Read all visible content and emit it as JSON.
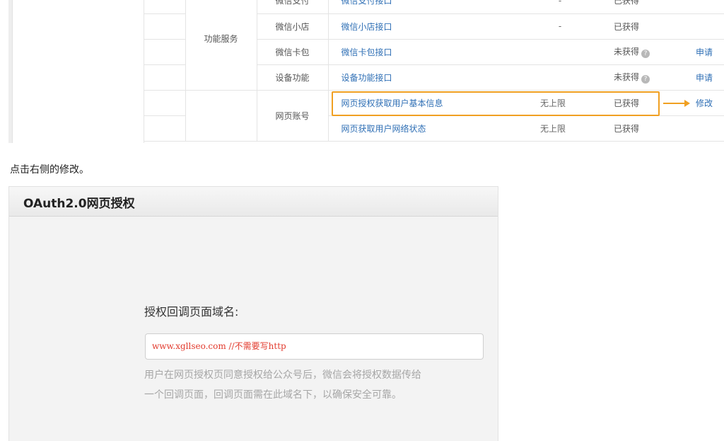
{
  "table": {
    "rows": [
      {
        "category": "",
        "name": "微信支付",
        "api": "微信支付接口",
        "limit": "-",
        "status": "已获得",
        "action": ""
      },
      {
        "category": "功能服务",
        "name": "微信小店",
        "api": "微信小店接口",
        "limit": "-",
        "status": "已获得",
        "action": ""
      },
      {
        "category": "",
        "name": "微信卡包",
        "api": "微信卡包接口",
        "limit": "",
        "status": "未获得",
        "action": "申请"
      },
      {
        "category": "",
        "name": "设备功能",
        "api": "设备功能接口",
        "limit": "",
        "status": "未获得",
        "action": "申请"
      },
      {
        "category": "",
        "name": "网页账号",
        "api": "网页授权获取用户基本信息",
        "limit": "无上限",
        "status": "已获得",
        "action": "修改"
      },
      {
        "category": "",
        "name": "",
        "api": "网页获取用户网络状态",
        "limit": "无上限",
        "status": "已获得",
        "action": ""
      }
    ],
    "help_icon": "question-circle-icon",
    "highlight_color": "#f0a022"
  },
  "caption": "点击右侧的修改。",
  "oauth": {
    "title": "OAuth2.0网页授权",
    "field_label": "授权回调页面域名:",
    "input_value": "www.xgllseo.com  //不需要写http",
    "help_line1": "用户在网页授权页同意授权给公众号后，微信会将授权数据传给",
    "help_line2": "一个回调页面，回调页面需在此域名下，以确保安全可靠。"
  }
}
